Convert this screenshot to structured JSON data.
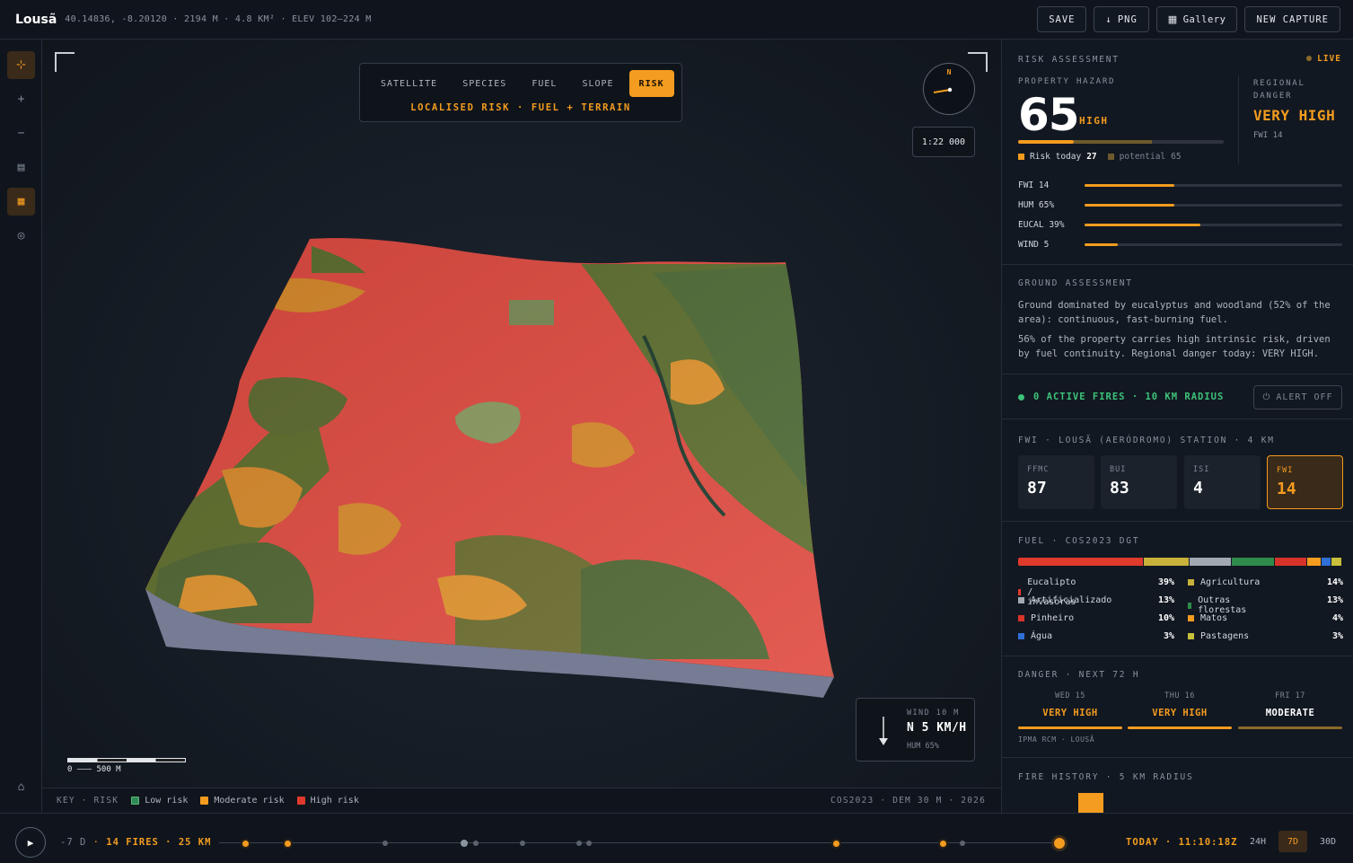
{
  "header": {
    "title": "Lousã",
    "meta": "40.14836, -8.20120 · 2194 M · 4.8 KM² · ELEV 102–224 M",
    "save": "SAVE",
    "png": "PNG",
    "gallery": "Gallery",
    "new_capture": "NEW CAPTURE"
  },
  "map": {
    "tabs": [
      "SATELLITE",
      "SPECIES",
      "FUEL",
      "SLOPE",
      "RISK"
    ],
    "active_tab": "RISK",
    "subtitle": "LOCALISED RISK · FUEL + TERRAIN",
    "compass_label": "N",
    "scale_ratio": "1:22 000",
    "wind_label": "WIND 10 M",
    "wind_value": "N 5 KM/H",
    "wind_hum": "HUM 65%",
    "scale_bar_label": "0 ——— 500 M",
    "key_title": "KEY · RISK",
    "key_items": [
      {
        "label": "Low risk",
        "color": "#2e8b57"
      },
      {
        "label": "Moderate risk",
        "color": "#f39c1f"
      },
      {
        "label": "High risk",
        "color": "#e03a2c"
      }
    ],
    "key_source": "COS2023 · DEM 30 M · 2026"
  },
  "risk": {
    "title": "RISK ASSESSMENT",
    "live": "LIVE",
    "property_label": "PROPERTY HAZARD",
    "score": "65",
    "score_level": "HIGH",
    "today_label": "Risk today",
    "today_value": "27",
    "potential_label": "potential",
    "potential_value": "65",
    "regional_label_1": "REGIONAL",
    "regional_label_2": "DANGER",
    "regional_value": "VERY HIGH",
    "regional_fwi": "FWI 14",
    "metrics": [
      {
        "label": "FWI 14",
        "fraction": 0.35
      },
      {
        "label": "HUM 65%",
        "fraction": 0.35
      },
      {
        "label": "EUCAL 39%",
        "fraction": 0.45
      },
      {
        "label": "WIND 5",
        "fraction": 0.13
      }
    ]
  },
  "ground": {
    "title": "GROUND ASSESSMENT",
    "p1": "Ground dominated by eucalyptus and woodland (52% of the area): continuous, fast-burning fuel.",
    "p2": "56% of the property carries high intrinsic risk, driven by fuel continuity. Regional danger today: VERY HIGH."
  },
  "fires": {
    "status": "0 ACTIVE FIRES · 10 KM RADIUS",
    "alert_button": "ALERT OFF"
  },
  "fwi": {
    "title": "FWI · LOUSÃ (AERÓDROMO) STATION · 4 KM",
    "cards": [
      {
        "label": "FFMC",
        "value": "87"
      },
      {
        "label": "BUI",
        "value": "83"
      },
      {
        "label": "ISI",
        "value": "4"
      },
      {
        "label": "FWI",
        "value": "14"
      }
    ]
  },
  "fuel": {
    "title": "FUEL · COS2023 DGT",
    "items": [
      {
        "label": "Eucalipto / invasoras",
        "pct": "39%",
        "color": "#e03a2c"
      },
      {
        "label": "Agricultura",
        "pct": "14%",
        "color": "#c8b23a"
      },
      {
        "label": "Artificializado",
        "pct": "13%",
        "color": "#a3a9b3"
      },
      {
        "label": "Outras florestas",
        "pct": "13%",
        "color": "#2e8b4a"
      },
      {
        "label": "Pinheiro",
        "pct": "10%",
        "color": "#d8332a"
      },
      {
        "label": "Matos",
        "pct": "4%",
        "color": "#f39c1f"
      },
      {
        "label": "Água",
        "pct": "3%",
        "color": "#2f6fd6"
      },
      {
        "label": "Pastagens",
        "pct": "3%",
        "color": "#c8c03a"
      }
    ]
  },
  "danger": {
    "title": "DANGER · NEXT 72 H",
    "days": [
      {
        "day": "WED 15",
        "level": "VERY HIGH",
        "color": "#f39c1f"
      },
      {
        "day": "THU 16",
        "level": "VERY HIGH",
        "color": "#f39c1f"
      },
      {
        "day": "FRI 17",
        "level": "MODERATE",
        "color": "#8a6a2a"
      }
    ],
    "source": "IPMA RCM · LOUSÃ"
  },
  "history": {
    "title": "FIRE HISTORY · 5 KM RADIUS"
  },
  "timeline": {
    "range_text": "-7 D",
    "fires_text": "14 FIRES · 25 KM",
    "today": "TODAY · 11:10:18Z",
    "ranges": [
      "24H",
      "7D",
      "30D"
    ],
    "active_range": "7D"
  }
}
